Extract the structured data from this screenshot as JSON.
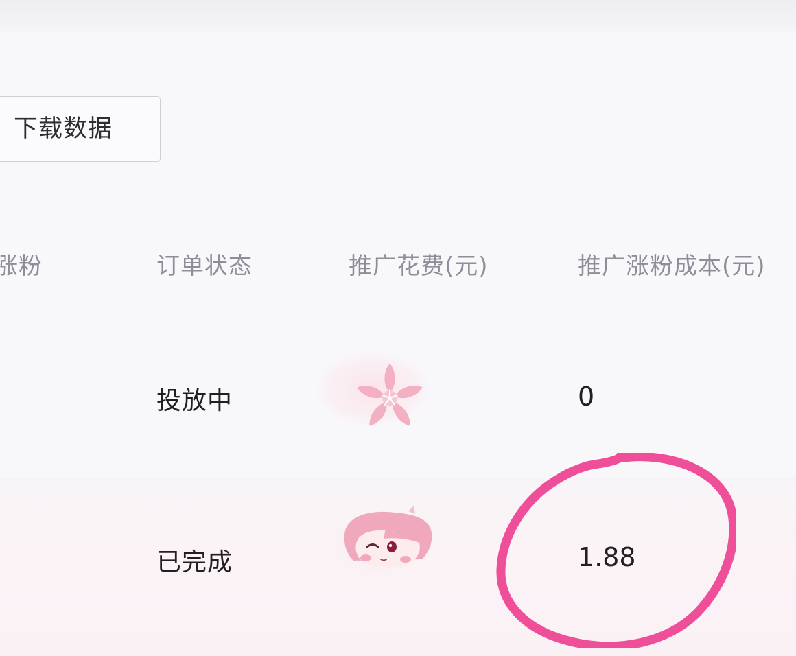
{
  "toolbar": {
    "download_label": "下载数据"
  },
  "table": {
    "columns": [
      "涨粉",
      "订单状态",
      "推广花费(元)",
      "推广涨粉成本(元)"
    ],
    "rows": [
      {
        "status": "投放中",
        "cost_per_follower": "0"
      },
      {
        "status": "已完成",
        "cost_per_follower": "1.88"
      }
    ]
  },
  "colors": {
    "annotation_circle": "#ee4f98",
    "sticker_pink": "#f2b3c4"
  },
  "icons": [
    "cherry-blossom-sticker-icon",
    "cartoon-face-sticker-icon"
  ]
}
